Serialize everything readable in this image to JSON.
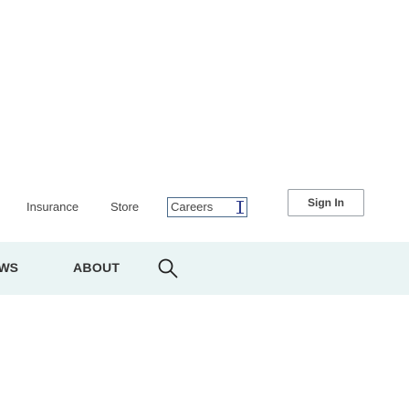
{
  "topnav": {
    "insurance": "Insurance",
    "store": "Store",
    "careers": "Careers",
    "signin": "Sign In"
  },
  "subnav": {
    "cut_label": "WS",
    "about": "ABOUT",
    "search_icon": "search-icon"
  },
  "colors": {
    "subnav_background": "#eaf4f4",
    "focus_border": "#4a6a8a"
  }
}
